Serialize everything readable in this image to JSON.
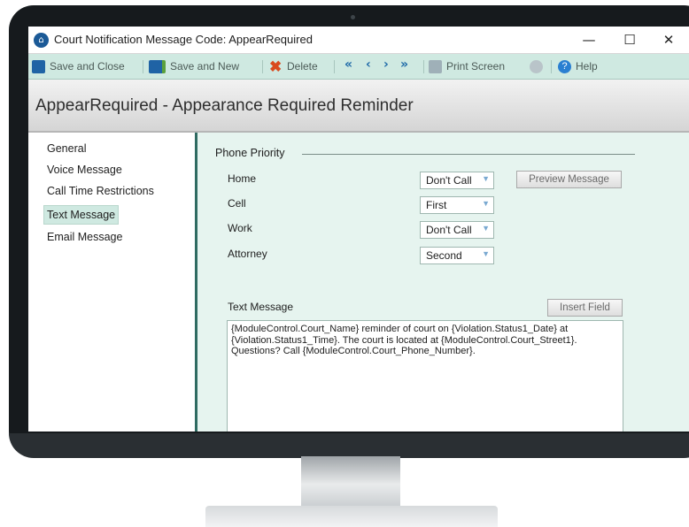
{
  "window": {
    "title": "Court Notification Message Code: AppearRequired",
    "minimize": "—",
    "maximize": "☐",
    "close": "✕"
  },
  "toolbar": {
    "save_close": "Save and Close",
    "save_new": "Save and New",
    "delete": "Delete",
    "print_screen": "Print Screen",
    "help": "Help"
  },
  "header": {
    "title": "AppearRequired - Appearance Required Reminder"
  },
  "sidebar": {
    "items": [
      {
        "label": "General"
      },
      {
        "label": "Voice Message"
      },
      {
        "label": "Call Time Restrictions"
      },
      {
        "label": "Text Message"
      },
      {
        "label": "Email Message"
      }
    ],
    "active_item": "Text Message"
  },
  "phone_priority": {
    "group_label": "Phone Priority",
    "rows": [
      {
        "label": "Home",
        "value": "Don't Call"
      },
      {
        "label": "Cell",
        "value": "First"
      },
      {
        "label": "Work",
        "value": "Don't Call"
      },
      {
        "label": "Attorney",
        "value": "Second"
      }
    ],
    "preview_button": "Preview Message"
  },
  "text_message": {
    "label": "Text Message",
    "insert_field_button": "Insert Field",
    "body": "{ModuleControl.Court_Name} reminder of court on {Violation.Status1_Date} at\n{Violation.Status1_Time}. The court is located at {ModuleControl.Court_Street1}.\nQuestions? Call {ModuleControl.Court_Phone_Number}."
  },
  "colors": {
    "toolbar_bg": "#cfe9e1",
    "content_bg": "#e6f4ef",
    "sidebar_divider": "#2f6b62",
    "accent_blue": "#1f6aa8"
  }
}
